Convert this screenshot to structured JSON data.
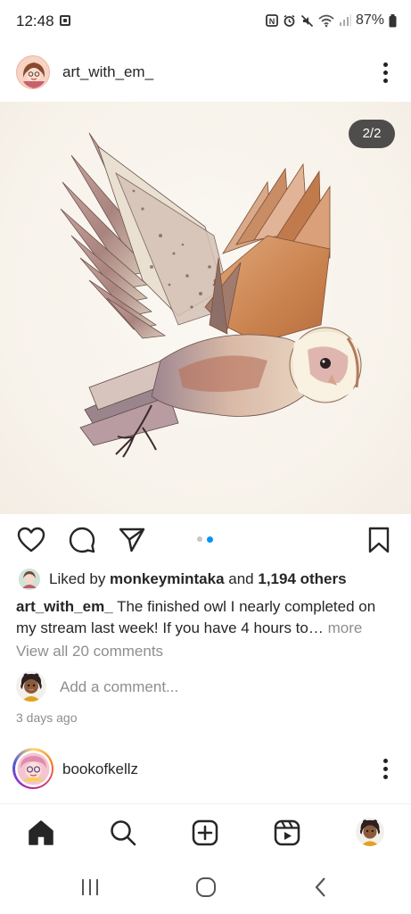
{
  "status_bar": {
    "time": "12:48",
    "battery": "87%"
  },
  "post": {
    "username": "art_with_em_",
    "image_counter": "2/2",
    "carousel": {
      "count": 2,
      "active_index": 1
    },
    "liked_by_prefix": "Liked by ",
    "liked_by_user": "monkeymintaka",
    "liked_by_mid": " and ",
    "liked_by_others": "1,194 others",
    "caption_user": "art_with_em_",
    "caption_text": " The finished owl I nearly completed on my stream last week! If you have 4 hours to…",
    "caption_more": " more",
    "view_comments": "View all 20 comments",
    "add_comment_placeholder": "Add a comment...",
    "time_ago": "3 days ago"
  },
  "next_post": {
    "username": "bookofkellz"
  },
  "bottom_nav": {
    "items": [
      "home-icon",
      "search-icon",
      "new-post-icon",
      "reels-icon",
      "profile-avatar"
    ]
  },
  "system_nav": {
    "items": [
      "recents-icon",
      "home-circle-icon",
      "back-icon"
    ]
  },
  "colors": {
    "accent_blue": "#0095f6",
    "text": "#262626",
    "muted": "#8e8e8e"
  }
}
